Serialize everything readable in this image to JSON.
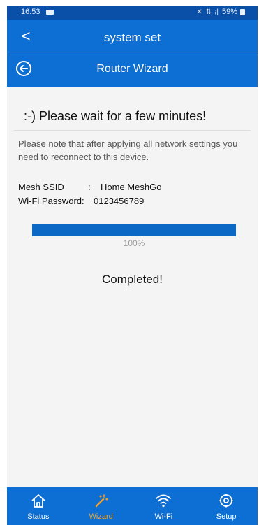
{
  "status_bar": {
    "time": "16:53",
    "icons": "✕ ⇅ ᵢ|",
    "battery": "59%"
  },
  "header": {
    "back_glyph": "<",
    "title": "system set",
    "subtitle": "Router Wizard"
  },
  "content": {
    "heading": ":-) Please wait for a few minutes!",
    "note": "Please note that after applying all network settings you need to reconnect to this device.",
    "mesh_ssid_label": "Mesh SSID",
    "mesh_ssid_sep": ":",
    "mesh_ssid_value": "Home MeshGo",
    "wifi_password_label": "Wi-Fi Password:",
    "wifi_password_value": "0123456789",
    "progress_fraction": 1.0,
    "progress_text": "100%",
    "completed_text": "Completed!"
  },
  "tabbar": {
    "tabs": [
      {
        "label": "Status",
        "icon": "home-icon",
        "active": false
      },
      {
        "label": "Wizard",
        "icon": "wand-icon",
        "active": true
      },
      {
        "label": "Wi-Fi",
        "icon": "wifi-icon",
        "active": false
      },
      {
        "label": "Setup",
        "icon": "gear-icon",
        "active": false
      }
    ]
  },
  "colors": {
    "header_blue": "#0d6ed3",
    "status_blue": "#0a4fa8",
    "progress_blue": "#0b68c4",
    "active_tab": "#f4a02a"
  }
}
